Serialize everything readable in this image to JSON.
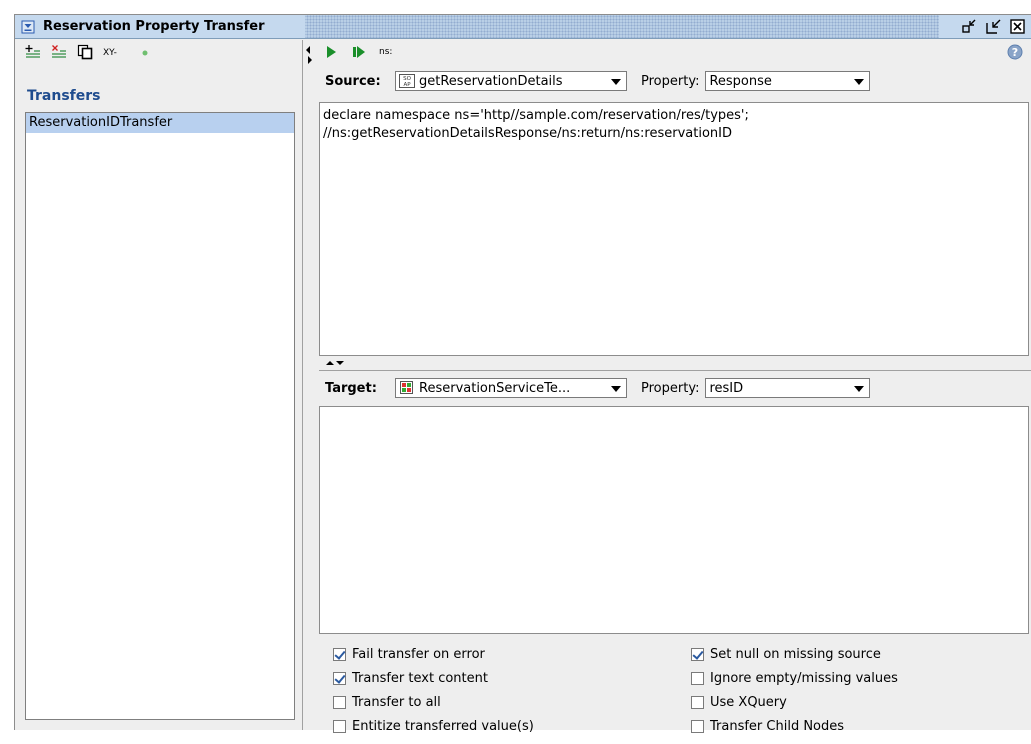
{
  "window": {
    "title": "Reservation Property Transfer"
  },
  "left": {
    "toolbar": {
      "xy_label": "XY-"
    },
    "heading": "Transfers",
    "items": [
      "ReservationIDTransfer"
    ]
  },
  "right": {
    "toolbar": {
      "ns_label": "ns:"
    },
    "source": {
      "label": "Source:",
      "step": "getReservationDetails",
      "property_label": "Property:",
      "property": "Response",
      "expression_line1": "declare namespace ns='http//sample.com/reservation/res/types';",
      "expression_line2": "//ns:getReservationDetailsResponse/ns:return/ns:reservationID"
    },
    "target": {
      "label": "Target:",
      "step": "ReservationServiceTe...",
      "property_label": "Property:",
      "property": "resID",
      "expression": ""
    },
    "options": [
      {
        "label": "Fail transfer on error",
        "checked": true
      },
      {
        "label": "Set null on missing source",
        "checked": true
      },
      {
        "label": "Transfer text content",
        "checked": true
      },
      {
        "label": "Ignore empty/missing values",
        "checked": false
      },
      {
        "label": "Transfer to all",
        "checked": false
      },
      {
        "label": "Use XQuery",
        "checked": false
      },
      {
        "label": "Entitize transferred value(s)",
        "checked": false
      },
      {
        "label": "Transfer Child Nodes",
        "checked": false
      }
    ]
  },
  "colors": {
    "title_bg": "#c5d9ee",
    "heading_text": "#1f4c8e",
    "selection": "#b8d0ef",
    "run_green": "#1a8f2a"
  },
  "icons": [
    "collapse-icon",
    "add-transfer-icon",
    "remove-transfer-icon",
    "copy-icon",
    "run-icon",
    "run-all-icon",
    "help-icon",
    "soap-request-icon",
    "testcase-icon"
  ]
}
